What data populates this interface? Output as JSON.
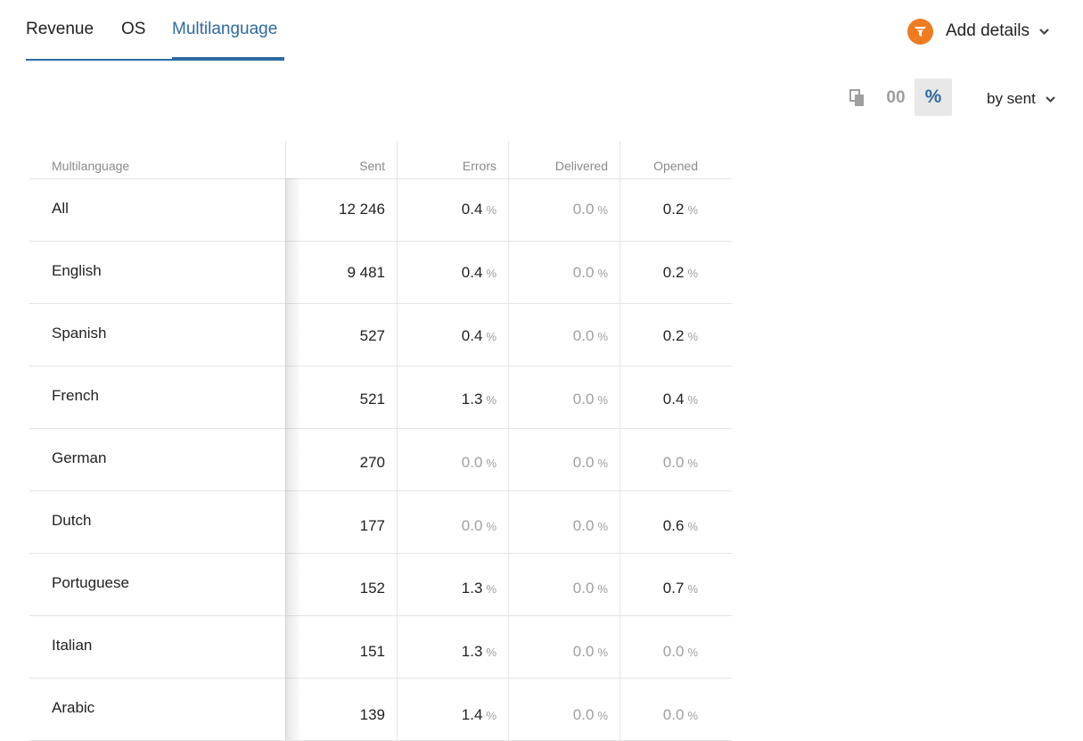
{
  "tabs": [
    {
      "label": "Revenue"
    },
    {
      "label": "OS"
    },
    {
      "label": "Multilanguage",
      "active": true
    }
  ],
  "add_details": {
    "label": "Add details",
    "icon": "funnel-icon",
    "accent": "#f07c21"
  },
  "toolbar": {
    "zeros_label": "00",
    "percent_label": "%",
    "sort_label": "by sent"
  },
  "colors": {
    "accent": "#2e6aa3",
    "muted": "#a0a0a0"
  },
  "table": {
    "headers": [
      "Multilanguage",
      "Sent",
      "Errors",
      "Delivered",
      "Opened"
    ],
    "percent_sign": "%",
    "rows": [
      {
        "name": "All",
        "sent": "12 246",
        "errors": "0.4",
        "delivered": "0.0",
        "opened": "0.2"
      },
      {
        "name": "English",
        "sent": "9 481",
        "errors": "0.4",
        "delivered": "0.0",
        "opened": "0.2"
      },
      {
        "name": "Spanish",
        "sent": "527",
        "errors": "0.4",
        "delivered": "0.0",
        "opened": "0.2"
      },
      {
        "name": "French",
        "sent": "521",
        "errors": "1.3",
        "delivered": "0.0",
        "opened": "0.4"
      },
      {
        "name": "German",
        "sent": "270",
        "errors": "0.0",
        "delivered": "0.0",
        "opened": "0.0"
      },
      {
        "name": "Dutch",
        "sent": "177",
        "errors": "0.0",
        "delivered": "0.0",
        "opened": "0.6"
      },
      {
        "name": "Portuguese",
        "sent": "152",
        "errors": "1.3",
        "delivered": "0.0",
        "opened": "0.7"
      },
      {
        "name": "Italian",
        "sent": "151",
        "errors": "1.3",
        "delivered": "0.0",
        "opened": "0.0"
      },
      {
        "name": "Arabic",
        "sent": "139",
        "errors": "1.4",
        "delivered": "0.0",
        "opened": "0.0"
      }
    ]
  }
}
